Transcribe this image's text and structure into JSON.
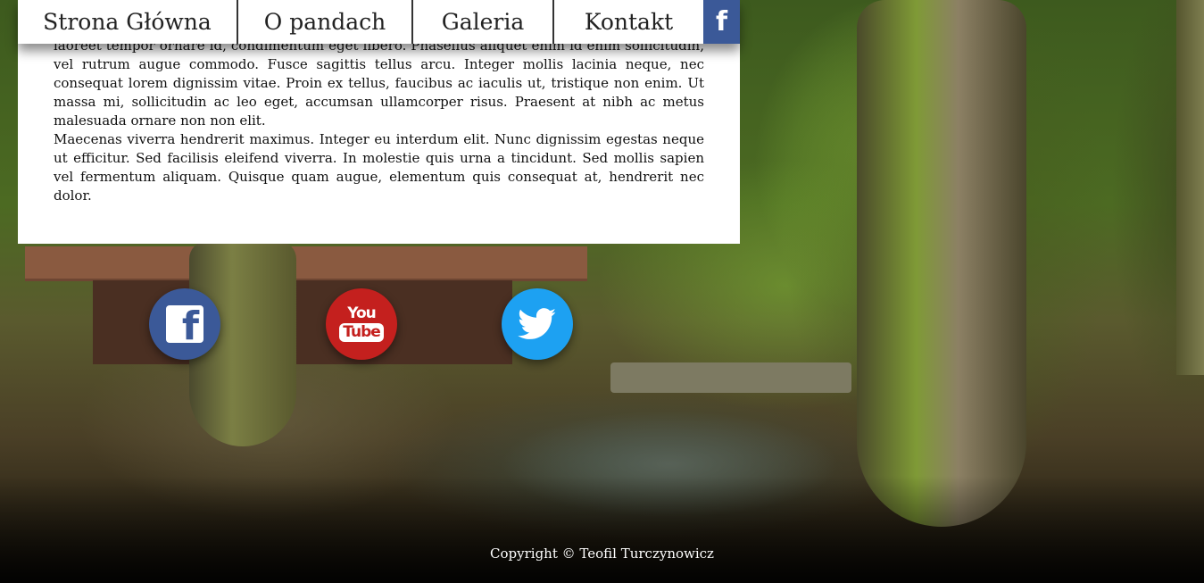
{
  "nav": {
    "items": [
      {
        "label": "Strona Główna"
      },
      {
        "label": "O pandach"
      },
      {
        "label": "Galeria"
      },
      {
        "label": "Kontakt"
      }
    ],
    "facebook_label": "f"
  },
  "content": {
    "paragraph1": "laoreet tempor ornare id, condimentum eget libero. Phasellus aliquet enim id enim sollicitudin, vel rutrum augue commodo. Fusce sagittis tellus arcu. Integer mollis lacinia neque, nec consequat lorem dignissim vitae. Proin ex tellus, faucibus ac iaculis ut, tristique non enim. Ut massa mi, sollicitudin ac leo eget, accumsan ullamcorper risus. Praesent at nibh ac metus malesuada ornare non non elit.",
    "paragraph2": "Maecenas viverra hendrerit maximus. Integer eu interdum elit. Nunc dignissim egestas neque ut efficitur. Sed facilisis eleifend viverra. In molestie quis urna a tincidunt. Sed mollis sapien vel fermentum aliquam. Quisque quam augue, elementum quis consequat at, hendrerit nec dolor."
  },
  "social": {
    "facebook": {
      "icon": "facebook-icon",
      "color": "#3b5998"
    },
    "youtube": {
      "icon": "youtube-icon",
      "color": "#c4201e",
      "line1": "You",
      "line2": "Tube"
    },
    "twitter": {
      "icon": "twitter-icon",
      "color": "#1da1f2"
    }
  },
  "footer": {
    "text": "Copyright © Teofil Turczynowicz"
  }
}
